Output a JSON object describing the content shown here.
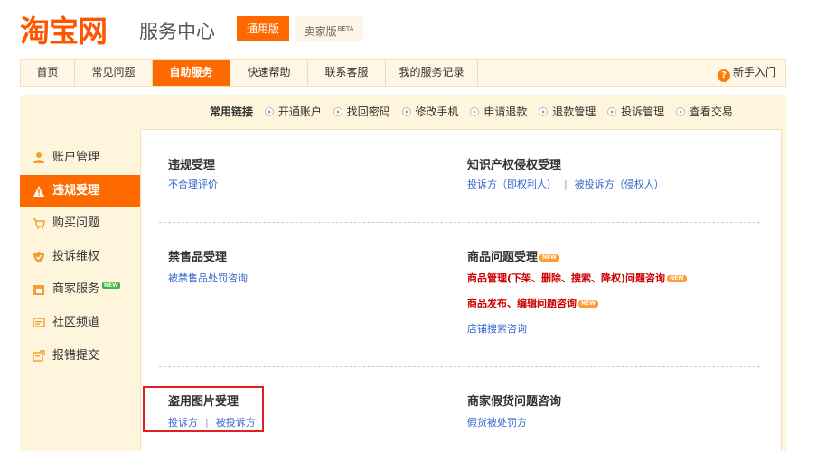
{
  "header": {
    "logo_text": "淘宝网",
    "subtitle": "服务中心",
    "version_tabs": [
      {
        "label": "通用版",
        "active": true
      },
      {
        "label": "卖家版",
        "badge": "BETA",
        "active": false
      }
    ]
  },
  "nav": {
    "items": [
      {
        "label": "首页"
      },
      {
        "label": "常见问题"
      },
      {
        "label": "自助服务",
        "active": true
      },
      {
        "label": "快速帮助"
      },
      {
        "label": "联系客服"
      },
      {
        "label": "我的服务记录"
      }
    ],
    "help_label": "新手入门",
    "help_icon": "question-icon"
  },
  "quick_links": {
    "label": "常用链接",
    "items": [
      "开通账户",
      "找回密码",
      "修改手机",
      "申请退款",
      "退款管理",
      "投诉管理",
      "查看交易"
    ]
  },
  "sidebar": {
    "items": [
      {
        "label": "账户管理",
        "icon": "user-icon"
      },
      {
        "label": "违规受理",
        "icon": "warning-icon",
        "active": true
      },
      {
        "label": "购买问题",
        "icon": "cart-icon"
      },
      {
        "label": "投诉维权",
        "icon": "shield-icon"
      },
      {
        "label": "商家服务",
        "icon": "store-icon",
        "badge": "NEW"
      },
      {
        "label": "社区频道",
        "icon": "community-icon"
      },
      {
        "label": "报错提交",
        "icon": "report-icon"
      }
    ]
  },
  "sections": {
    "violation": {
      "title": "违规受理",
      "links": [
        "不合理评价"
      ]
    },
    "ip": {
      "title": "知识产权侵权受理",
      "links": [
        "投诉方（即权利人）",
        "被投诉方（侵权人）"
      ]
    },
    "banned": {
      "title": "禁售品受理",
      "links": [
        "被禁售品处罚咨询"
      ]
    },
    "product": {
      "title": "商品问题受理",
      "title_badge": "NEW",
      "links": [
        {
          "label": "商品管理(下架、删除、搜索、降权)问题咨询",
          "badge": "NEW"
        },
        {
          "label": "商品发布、编辑问题咨询",
          "badge": "NEW"
        },
        {
          "label": "店铺搜索咨询"
        }
      ]
    },
    "image_theft": {
      "title": "盗用图片受理",
      "links": [
        "投诉方",
        "被投诉方"
      ]
    },
    "fake": {
      "title": "商家假货问题咨询",
      "links": [
        "假货被处罚方"
      ]
    }
  },
  "colors": {
    "brand_orange": "#ff6a00",
    "nav_bg": "#fff6e5",
    "main_bg": "#fff4dc",
    "link_blue": "#3366cc",
    "highlight_red": "#cc0000",
    "annotation_box": "#e02020"
  }
}
